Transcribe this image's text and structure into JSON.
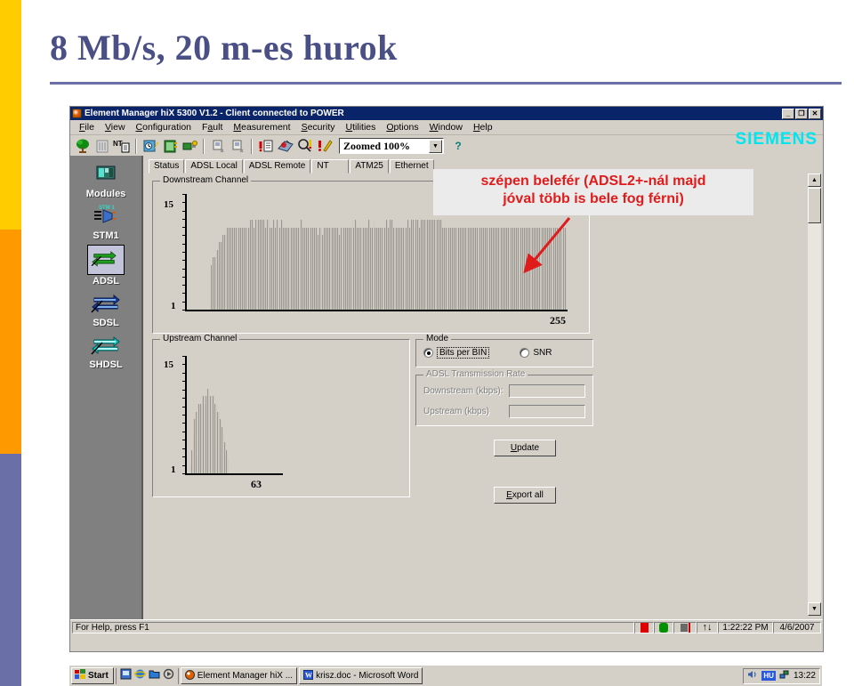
{
  "slide": {
    "title": "8 Mb/s, 20 m-es hurok",
    "accent_yellow": "#ffcc00",
    "accent_orange": "#ff9900",
    "accent_purple": "#6b6fa8",
    "title_color": "#4a4f86"
  },
  "annotation": {
    "line1": "szépen belefér (ADSL2+-nál majd",
    "line2": "jóval több is bele fog férni)",
    "color": "#e01b1b"
  },
  "window": {
    "title": "Element Manager hiX 5300 V1.2 - Client connected to POWER",
    "app_icon": "app-icon",
    "minimize": "_",
    "restore": "❐",
    "close": "✕",
    "brand": "SIEMENS",
    "brand_color": "#00e5ef"
  },
  "menu": [
    {
      "label": "File",
      "mnemonic": "F"
    },
    {
      "label": "View",
      "mnemonic": "V"
    },
    {
      "label": "Configuration",
      "mnemonic": "C"
    },
    {
      "label": "Fault",
      "mnemonic": "a"
    },
    {
      "label": "Measurement",
      "mnemonic": "M"
    },
    {
      "label": "Security",
      "mnemonic": "S"
    },
    {
      "label": "Utilities",
      "mnemonic": "U"
    },
    {
      "label": "Options",
      "mnemonic": "O"
    },
    {
      "label": "Window",
      "mnemonic": "W"
    },
    {
      "label": "Help",
      "mnemonic": "H"
    }
  ],
  "toolbar": {
    "icons": [
      "network-tree-icon",
      "rack-icon",
      "nt-document-icon",
      "history-document-icon",
      "card-icon",
      "connector-icon",
      "document-small-icon",
      "document-small-2-icon",
      "alarm-document-icon",
      "alarm-map-icon",
      "search-alarm-icon",
      "alarm-edit-icon"
    ],
    "zoom_value": "Zoomed 100%",
    "zoom_arrow": "▼",
    "help_label": "?"
  },
  "sidebar": {
    "items": [
      {
        "label": "Modules",
        "icon": "module-card-icon",
        "selected": false
      },
      {
        "label": "STM1",
        "icon": "stm1-icon",
        "selected": false
      },
      {
        "label": "ADSL",
        "icon": "adsl-arrows-icon",
        "selected": true
      },
      {
        "label": "SDSL",
        "icon": "sdsl-arrows-icon",
        "selected": false
      },
      {
        "label": "SHDSL",
        "icon": "shdsl-arrows-icon",
        "selected": false
      }
    ]
  },
  "tabs": [
    {
      "label": "Status",
      "active": false
    },
    {
      "label": "ADSL Local",
      "active": false
    },
    {
      "label": "ADSL Remote",
      "active": false
    },
    {
      "label": "NT",
      "active": false
    },
    {
      "label": "ATM25",
      "active": false
    },
    {
      "label": "Ethernet",
      "active": false
    }
  ],
  "groups": {
    "downstream": "Downstream Channel",
    "upstream": "Upstream Channel",
    "mode": "Mode",
    "rate": "ADSL Transmission Rate"
  },
  "mode": {
    "bits_per_bin": "Bits per BIN",
    "snr": "SNR",
    "selected": "Bits per BIN"
  },
  "rate": {
    "downstream_label": "Downstream (kbps):",
    "downstream_value": "",
    "upstream_label": "Upstream (kbps)",
    "upstream_value": "",
    "enabled": false
  },
  "buttons": {
    "update": "Update",
    "export_all": "Export all"
  },
  "statusbar": {
    "hint": "For Help, press F1",
    "time": "1:22:22 PM",
    "date": "4/6/2007",
    "indicators": [
      "alarm-red-icon",
      "db-green-icon",
      "net-icon",
      "traffic-arrows-icon"
    ]
  },
  "taskbar": {
    "start": "Start",
    "quicklaunch": [
      "desktop-icon",
      "ie-icon",
      "explorer-icon",
      "media-icon"
    ],
    "tasks": [
      {
        "label": "Element Manager hiX ...",
        "icon": "app-icon"
      },
      {
        "label": "krisz.doc - Microsoft Word",
        "icon": "word-icon"
      }
    ],
    "tray": [
      "volume-icon",
      "language-icon",
      "network-icon"
    ],
    "lang": "HU",
    "clock": "13:22"
  },
  "chart_data": [
    {
      "type": "bar",
      "title": "Downstream Channel",
      "xlabel": "",
      "ylabel": "",
      "ylim": [
        1,
        15
      ],
      "ytick_labels": [
        "1",
        "15"
      ],
      "xlim": [
        0,
        255
      ],
      "xtick_labels": [
        "255"
      ],
      "grid": false,
      "x": [
        0,
        1,
        2,
        3,
        4,
        5,
        6,
        7,
        8,
        9,
        10,
        11,
        12,
        13,
        14,
        15,
        16,
        17,
        18,
        19,
        20,
        21,
        22,
        23,
        24,
        25,
        26,
        27,
        28,
        29,
        30,
        31,
        32,
        33,
        34,
        35,
        36,
        37,
        38,
        39,
        40,
        41,
        42,
        43,
        44,
        45,
        46,
        47,
        48,
        49,
        50,
        51,
        52,
        53,
        54,
        55,
        56,
        57,
        58,
        59,
        60,
        61,
        62,
        63,
        64,
        65,
        66,
        67,
        68,
        69,
        70,
        71,
        72,
        73,
        74,
        75,
        76,
        77,
        78,
        79,
        80,
        81,
        82,
        83,
        84,
        85,
        86,
        87,
        88,
        89,
        90,
        91,
        92,
        93,
        94,
        95,
        96,
        97,
        98,
        99,
        100,
        101,
        102,
        103,
        104,
        105,
        106,
        107,
        108,
        109,
        110,
        111,
        112,
        113,
        114,
        115,
        116,
        117,
        118,
        119,
        120,
        121,
        122,
        123,
        124,
        125,
        126,
        127,
        128,
        129,
        130,
        131,
        132,
        133,
        134,
        135,
        136,
        137,
        138,
        139,
        140,
        141,
        142,
        143,
        144,
        145,
        146,
        147,
        148,
        149,
        150,
        151,
        152,
        153,
        154,
        155,
        156,
        157,
        158,
        159,
        160,
        161,
        162,
        163,
        164,
        165,
        166,
        167,
        168,
        169,
        170,
        171,
        172,
        173,
        174,
        175,
        176,
        177,
        178,
        179,
        180,
        181,
        182,
        183,
        184,
        185,
        186,
        187,
        188,
        189,
        190,
        191,
        192,
        193,
        194,
        195,
        196,
        197,
        198,
        199,
        200,
        201,
        202,
        203,
        204,
        205,
        206,
        207,
        208,
        209,
        210,
        211,
        212,
        213,
        214,
        215,
        216,
        217,
        218,
        219,
        220,
        221,
        222,
        223,
        224,
        225,
        226,
        227,
        228,
        229,
        230,
        231,
        232,
        233,
        234,
        235,
        236,
        237,
        238,
        239,
        240,
        241,
        242,
        243,
        244,
        245,
        246,
        247,
        248,
        249,
        250,
        251,
        252,
        253,
        254,
        255
      ],
      "values": [
        0,
        0,
        0,
        0,
        0,
        0,
        0,
        0,
        0,
        0,
        0,
        0,
        0,
        0,
        0,
        0,
        0,
        0,
        0,
        0,
        0,
        0,
        0,
        0,
        0,
        0,
        0,
        0,
        0,
        0,
        0,
        0,
        6,
        7,
        7,
        8,
        8,
        9,
        9,
        10,
        10,
        10,
        11,
        11,
        11,
        11,
        11,
        11,
        11,
        11,
        11,
        11,
        11,
        11,
        11,
        11,
        12,
        12,
        11,
        12,
        12,
        12,
        12,
        12,
        12,
        11,
        12,
        12,
        11,
        11,
        12,
        11,
        12,
        11,
        11,
        12,
        11,
        11,
        11,
        11,
        11,
        11,
        11,
        11,
        11,
        11,
        11,
        12,
        11,
        11,
        11,
        11,
        11,
        11,
        11,
        11,
        11,
        10,
        11,
        11,
        10,
        11,
        11,
        11,
        11,
        11,
        11,
        11,
        11,
        11,
        10,
        11,
        11,
        11,
        11,
        11,
        11,
        11,
        12,
        11,
        12,
        11,
        11,
        11,
        11,
        11,
        11,
        11,
        12,
        11,
        11,
        12,
        11,
        11,
        11,
        11,
        11,
        11,
        11,
        12,
        11,
        12,
        12,
        11,
        11,
        11,
        11,
        11,
        11,
        11,
        11,
        11,
        12,
        11,
        12,
        12,
        11,
        12,
        12,
        11,
        12,
        12,
        12,
        12,
        12,
        12,
        12,
        12,
        12,
        12,
        12,
        12,
        12,
        11,
        11,
        11,
        11,
        11,
        11,
        11,
        11,
        11,
        11,
        11,
        11,
        11,
        11,
        11,
        11,
        11,
        11,
        11,
        11,
        11,
        11,
        11,
        11,
        11,
        11,
        11,
        11,
        11,
        11,
        11,
        11,
        11,
        11,
        11,
        11,
        11,
        11,
        11,
        11,
        11,
        11,
        11,
        11,
        11,
        11,
        11,
        11,
        11,
        11,
        11,
        11,
        11,
        11,
        11,
        11,
        11,
        11,
        11,
        11,
        11,
        11,
        11,
        11,
        11,
        11,
        11,
        11,
        11,
        11,
        11,
        11,
        11,
        11,
        11,
        11
      ]
    },
    {
      "type": "bar",
      "title": "Upstream Channel",
      "xlabel": "",
      "ylabel": "",
      "ylim": [
        1,
        15
      ],
      "ytick_labels": [
        "1",
        "15"
      ],
      "xlim": [
        0,
        63
      ],
      "xtick_labels": [
        "63"
      ],
      "grid": false,
      "x": [
        0,
        1,
        2,
        3,
        4,
        5,
        6,
        7,
        8,
        9,
        10,
        11,
        12,
        13,
        14,
        15,
        16,
        17,
        18,
        19,
        20,
        21,
        22,
        23,
        24,
        25,
        26,
        27,
        28,
        29,
        30,
        31,
        32,
        33,
        34,
        35,
        36,
        37,
        38,
        39,
        40,
        41,
        42,
        43,
        44,
        45,
        46,
        47,
        48,
        49,
        50,
        51,
        52,
        53,
        54,
        55,
        56,
        57,
        58,
        59,
        60,
        61,
        62,
        63
      ],
      "values": [
        0,
        0,
        0,
        0,
        0,
        0,
        1,
        3,
        5,
        7,
        8,
        9,
        9,
        9,
        10,
        10,
        9,
        10,
        11,
        10,
        10,
        10,
        10,
        9,
        9,
        8,
        8,
        7,
        6,
        5,
        4,
        3,
        2,
        0,
        0,
        0,
        0,
        0,
        0,
        0,
        0,
        0,
        0,
        0,
        0,
        0,
        0,
        0,
        0,
        0,
        0,
        0,
        0,
        0,
        0,
        0,
        0,
        0,
        0,
        0,
        0,
        0,
        0,
        0
      ]
    }
  ]
}
